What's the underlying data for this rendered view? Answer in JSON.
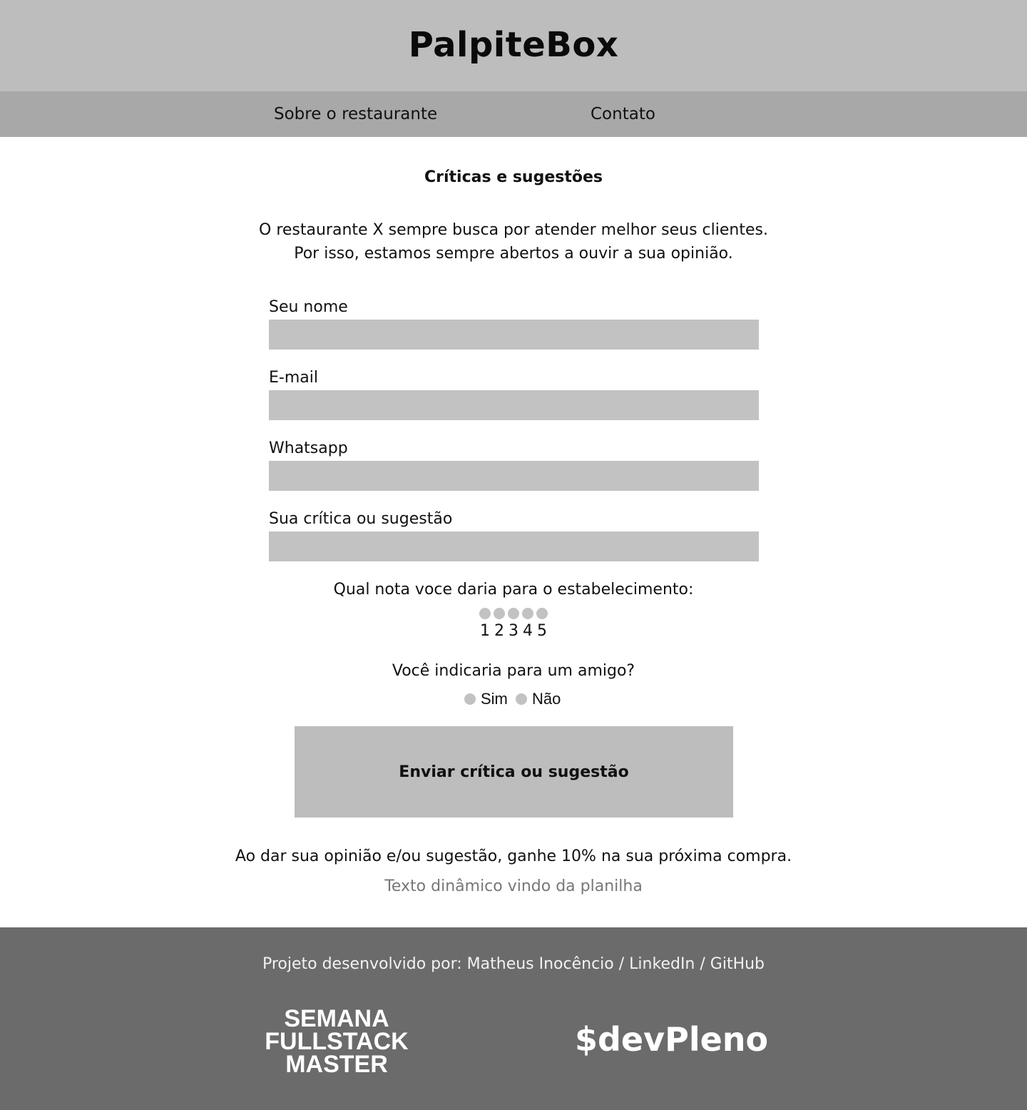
{
  "header": {
    "title": "PalpiteBox"
  },
  "nav": {
    "about": "Sobre o restaurante",
    "contact": "Contato"
  },
  "main": {
    "section_title": "Críticas e sugestões",
    "intro_line1": "O restaurante X sempre busca por atender melhor seus clientes.",
    "intro_line2": "Por isso, estamos sempre abertos a ouvir a sua opinião.",
    "fields": {
      "name": {
        "label": "Seu nome",
        "value": ""
      },
      "email": {
        "label": "E-mail",
        "value": ""
      },
      "whatsapp": {
        "label": "Whatsapp",
        "value": ""
      },
      "feedback": {
        "label": "Sua crítica ou sugestão",
        "value": ""
      }
    },
    "rating": {
      "question": "Qual nota voce daria para o estabelecimento:",
      "options": [
        "1",
        "2",
        "3",
        "4",
        "5"
      ]
    },
    "recommend": {
      "question": "Você indicaria para um amigo?",
      "yes": "Sim",
      "no": "Não"
    },
    "submit_label": "Enviar crítica ou sugestão",
    "promo": "Ao dar sua opinião e/ou sugestão, ganhe 10% na sua próxima compra.",
    "dynamic_text": "Texto dinâmico vindo da planilha"
  },
  "footer": {
    "credits_prefix": "Projeto desenvolvido por: ",
    "author": "Matheus Inocêncio",
    "separator1": " / ",
    "linkedin": "LinkedIn",
    "separator2": " / ",
    "github": "GitHub",
    "event_logo_line1": "SEMANA",
    "event_logo_line2": "FULLSTACK",
    "event_logo_line3": "MASTER",
    "sponsor_logo": "$devPleno"
  },
  "colors": {
    "header_bg": "#bdbdbd",
    "nav_bg": "#a8a8a8",
    "input_bg": "#c2c2c2",
    "footer_bg": "#6b6b6b",
    "muted_text": "#777777"
  }
}
